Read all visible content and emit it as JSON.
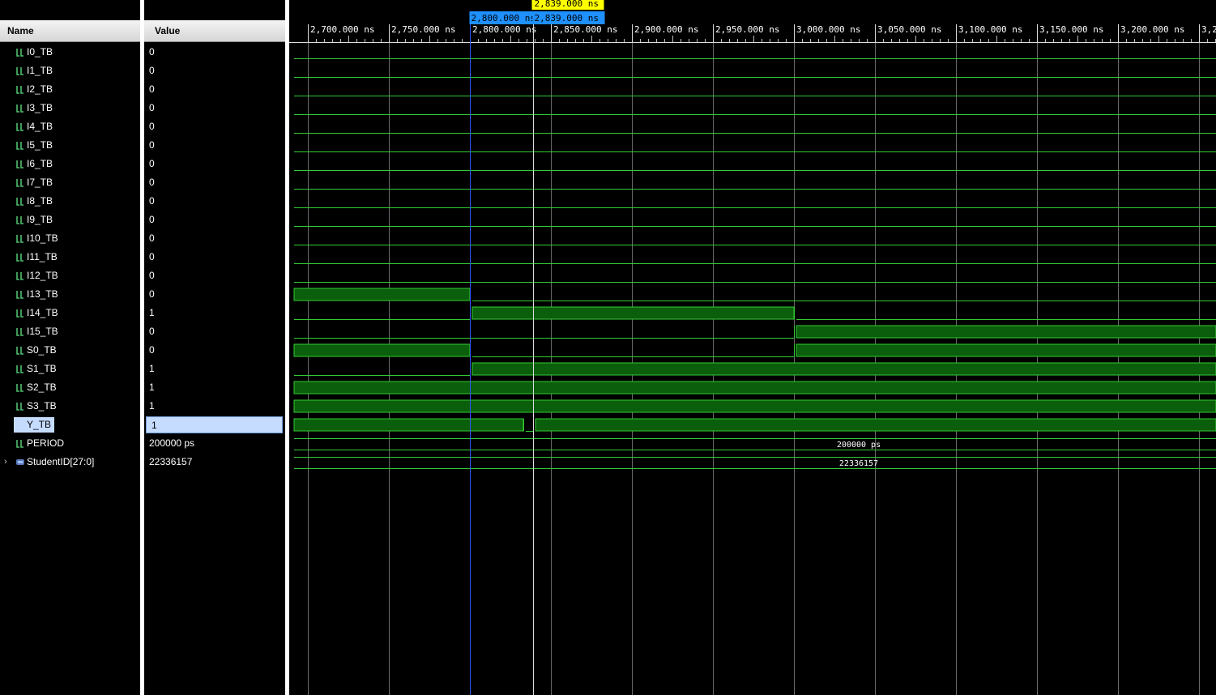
{
  "headers": {
    "name": "Name",
    "value": "Value"
  },
  "signals": [
    {
      "name": "I0_TB",
      "value": "0",
      "kind": "bit"
    },
    {
      "name": "I1_TB",
      "value": "0",
      "kind": "bit"
    },
    {
      "name": "I2_TB",
      "value": "0",
      "kind": "bit"
    },
    {
      "name": "I3_TB",
      "value": "0",
      "kind": "bit"
    },
    {
      "name": "I4_TB",
      "value": "0",
      "kind": "bit"
    },
    {
      "name": "I5_TB",
      "value": "0",
      "kind": "bit"
    },
    {
      "name": "I6_TB",
      "value": "0",
      "kind": "bit"
    },
    {
      "name": "I7_TB",
      "value": "0",
      "kind": "bit"
    },
    {
      "name": "I8_TB",
      "value": "0",
      "kind": "bit"
    },
    {
      "name": "I9_TB",
      "value": "0",
      "kind": "bit"
    },
    {
      "name": "I10_TB",
      "value": "0",
      "kind": "bit"
    },
    {
      "name": "I11_TB",
      "value": "0",
      "kind": "bit"
    },
    {
      "name": "I12_TB",
      "value": "0",
      "kind": "bit"
    },
    {
      "name": "I13_TB",
      "value": "0",
      "kind": "bit"
    },
    {
      "name": "I14_TB",
      "value": "1",
      "kind": "bit"
    },
    {
      "name": "I15_TB",
      "value": "0",
      "kind": "bit"
    },
    {
      "name": "S0_TB",
      "value": "0",
      "kind": "bit"
    },
    {
      "name": "S1_TB",
      "value": "1",
      "kind": "bit"
    },
    {
      "name": "S2_TB",
      "value": "1",
      "kind": "bit"
    },
    {
      "name": "S3_TB",
      "value": "1",
      "kind": "bit"
    },
    {
      "name": "Y_TB",
      "value": "1",
      "kind": "bit",
      "selected": true
    },
    {
      "name": "PERIOD",
      "value": "200000 ps",
      "kind": "param"
    },
    {
      "name": "StudentID[27:0]",
      "value": "22336157",
      "kind": "bus"
    }
  ],
  "timeline": {
    "ticks": [
      "2,700.000 ns",
      "2,750.000 ns",
      "2,800.000 ns",
      "2,850.000 ns",
      "2,900.000 ns",
      "2,950.000 ns",
      "3,000.000 ns",
      "3,050.000 ns",
      "3,100.000 ns",
      "3,150.000 ns",
      "3,200.000 ns",
      "3,2"
    ],
    "cursor_label": "2,839.000 ns",
    "marker_label": "2,800.000 ns",
    "cursor_marker_label": "2,839.000 ns"
  },
  "waveforms": {
    "I0_TB": [
      [
        2690,
        0
      ]
    ],
    "I1_TB": [
      [
        2690,
        0
      ]
    ],
    "I2_TB": [
      [
        2690,
        0
      ]
    ],
    "I3_TB": [
      [
        2690,
        0
      ]
    ],
    "I4_TB": [
      [
        2690,
        0
      ]
    ],
    "I5_TB": [
      [
        2690,
        0
      ]
    ],
    "I6_TB": [
      [
        2690,
        0
      ]
    ],
    "I7_TB": [
      [
        2690,
        0
      ]
    ],
    "I8_TB": [
      [
        2690,
        0
      ]
    ],
    "I9_TB": [
      [
        2690,
        0
      ]
    ],
    "I10_TB": [
      [
        2690,
        0
      ]
    ],
    "I11_TB": [
      [
        2690,
        0
      ]
    ],
    "I12_TB": [
      [
        2690,
        0
      ]
    ],
    "I13_TB": [
      [
        2690,
        1
      ],
      [
        2800,
        0
      ]
    ],
    "I14_TB": [
      [
        2690,
        0
      ],
      [
        2800,
        1
      ],
      [
        3000,
        0
      ]
    ],
    "I15_TB": [
      [
        2690,
        0
      ],
      [
        3000,
        1
      ]
    ],
    "S0_TB": [
      [
        2690,
        1
      ],
      [
        2800,
        0
      ],
      [
        3000,
        1
      ]
    ],
    "S1_TB": [
      [
        2690,
        0
      ],
      [
        2800,
        1
      ]
    ],
    "S2_TB": [
      [
        2690,
        1
      ]
    ],
    "S3_TB": [
      [
        2690,
        1
      ]
    ],
    "Y_TB": [
      [
        2690,
        1
      ],
      [
        2833,
        0
      ],
      [
        2839,
        1
      ]
    ]
  },
  "bus_labels": {
    "PERIOD": "200000 ps",
    "StudentID[27:0]": "22336157"
  },
  "colors": {
    "wave": "#33cc33",
    "wave_fill": "#0b5e0b",
    "grid": "#6a6a6a",
    "marker": "#3355ff",
    "cursor_bg": "#ffff00",
    "marker_bg": "#1e90ff"
  }
}
